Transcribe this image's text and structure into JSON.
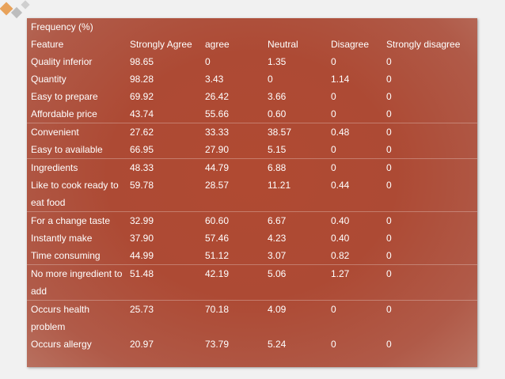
{
  "table": {
    "title": "Frequency (%)",
    "headers": [
      "Feature",
      "Strongly Agree",
      "agree",
      "Neutral",
      "Disagree",
      "Strongly disagree"
    ],
    "rows": [
      [
        "Quality inferior",
        "98.65",
        "0",
        "1.35",
        "0",
        "0"
      ],
      [
        "Quantity",
        "98.28",
        "3.43",
        "0",
        "1.14",
        "0"
      ],
      [
        "Easy to prepare",
        "69.92",
        "26.42",
        "3.66",
        "0",
        "0"
      ],
      [
        "Affordable price",
        "43.74",
        "55.66",
        "0.60",
        "0",
        "0"
      ],
      [
        "Convenient",
        "27.62",
        "33.33",
        "38.57",
        "0.48",
        "0"
      ],
      [
        "Easy to available",
        "66.95",
        "27.90",
        "5.15",
        "0",
        "0"
      ],
      [
        "Ingredients",
        "48.33",
        "44.79",
        "6.88",
        "0",
        "0"
      ],
      [
        "Like to cook ready to eat food",
        "59.78",
        "28.57",
        "11.21",
        "0.44",
        "0"
      ],
      [
        "For a change taste",
        "32.99",
        "60.60",
        "6.67",
        "0.40",
        "0"
      ],
      [
        "Instantly make",
        "37.90",
        "57.46",
        "4.23",
        "0.40",
        "0"
      ],
      [
        "Time consuming",
        "44.99",
        "51.12",
        "3.07",
        "0.82",
        "0"
      ],
      [
        "No more ingredient to add",
        "51.48",
        "42.19",
        "5.06",
        "1.27",
        "0"
      ],
      [
        "Occurs health problem",
        "25.73",
        "70.18",
        "4.09",
        "0",
        "0"
      ],
      [
        "Occurs allergy",
        "20.97",
        "73.79",
        "5.24",
        "0",
        "0"
      ]
    ]
  },
  "colors": {
    "panel": "#ad4a34",
    "text": "#ffffff",
    "background": "#f1f1f1",
    "deco_orange": "#e8a25a",
    "deco_grey": "#b9b9b9"
  }
}
